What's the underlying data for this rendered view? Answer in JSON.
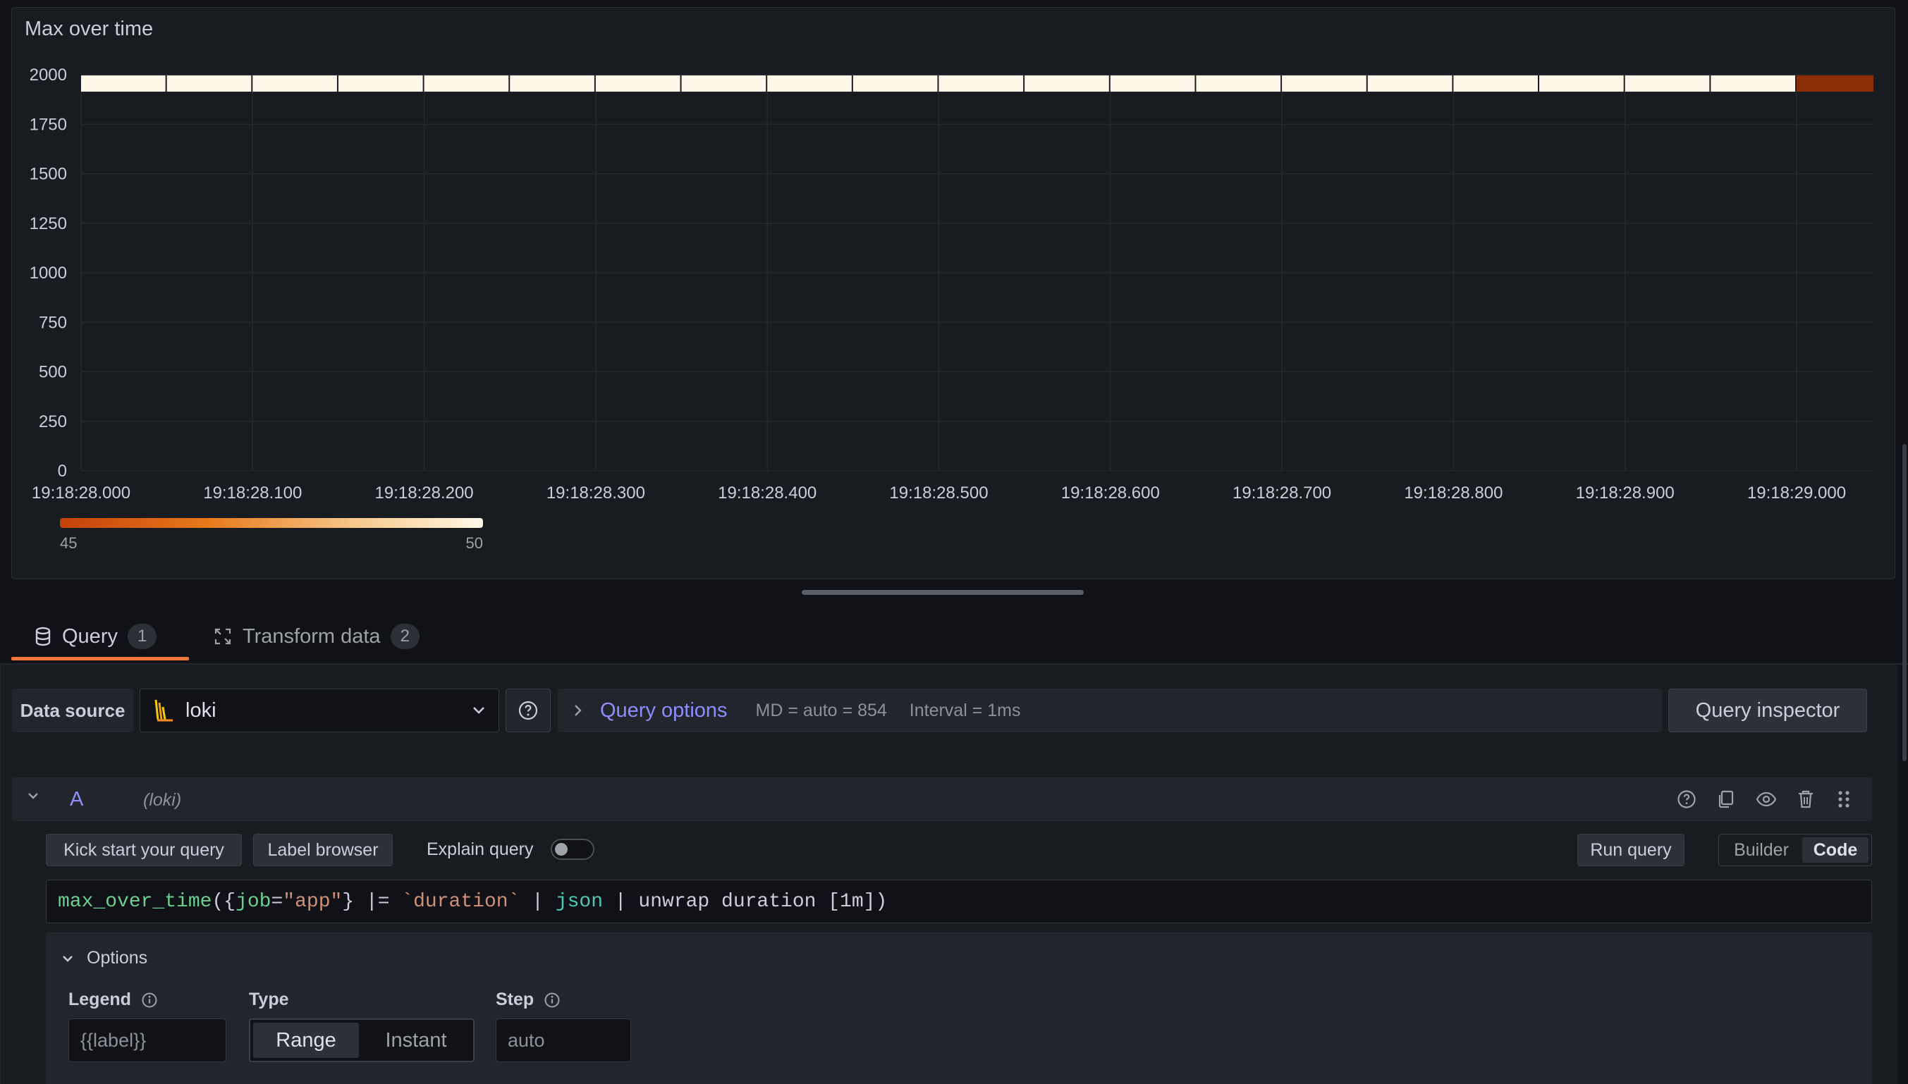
{
  "panel": {
    "title": "Max over time"
  },
  "chart_data": {
    "type": "heatmap",
    "title": "Max over time",
    "y_ticks": [
      "2000",
      "1750",
      "1500",
      "1250",
      "1000",
      "750",
      "500",
      "250",
      "0"
    ],
    "ylim": [
      0,
      2000
    ],
    "x_ticks": [
      "19:18:28.000",
      "19:18:28.100",
      "19:18:28.200",
      "19:18:28.300",
      "19:18:28.400",
      "19:18:28.500",
      "19:18:28.600",
      "19:18:28.700",
      "19:18:28.800",
      "19:18:28.900",
      "19:18:29.000"
    ],
    "row_bucket": [
      1950,
      2000
    ],
    "cells": [
      50,
      50,
      50,
      50,
      50,
      50,
      50,
      50,
      50,
      50,
      50,
      50,
      50,
      50,
      50,
      50,
      50,
      50,
      50,
      50,
      45
    ],
    "color_scale": {
      "min": 45,
      "max": 50,
      "min_color": "#c4410b",
      "max_color": "#fff8e8",
      "low_cell_color": "#8b2e08"
    },
    "legend": {
      "min_label": "45",
      "max_label": "50"
    },
    "grid": true
  },
  "tabs": [
    {
      "label": "Query",
      "count": "1",
      "icon": "database-icon"
    },
    {
      "label": "Transform data",
      "count": "2",
      "icon": "transform-icon"
    }
  ],
  "datasource": {
    "label": "Data source",
    "value": "loki",
    "query_options_label": "Query options",
    "md_text": "MD = auto = 854",
    "interval_text": "Interval = 1ms",
    "inspector_label": "Query inspector"
  },
  "query": {
    "ref": "A",
    "ds_name": "(loki)",
    "kick_start": "Kick start your query",
    "label_browser": "Label browser",
    "explain": "Explain query",
    "run": "Run query",
    "mode_builder": "Builder",
    "mode_code": "Code",
    "expr": {
      "fn": "max_over_time",
      "open": "({",
      "label_key": "job",
      "eq": "=",
      "label_val": "\"app\"",
      "close_sel": "}",
      "op": " |= ",
      "line_filter": "`duration`",
      "pipe1": " | ",
      "parser": "json",
      "rest": " | unwrap duration [1m])"
    },
    "options": {
      "header": "Options",
      "legend_label": "Legend",
      "legend_placeholder": "{{label}}",
      "type_label": "Type",
      "type_range": "Range",
      "type_instant": "Instant",
      "step_label": "Step",
      "step_placeholder": "auto"
    }
  }
}
